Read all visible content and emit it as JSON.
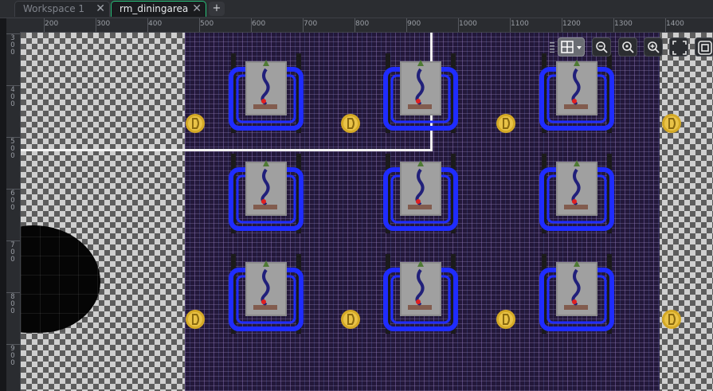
{
  "tabs": [
    {
      "label": "Workspace 1",
      "active": false
    },
    {
      "label": "rm_diningarea",
      "active": true
    }
  ],
  "tab_close_glyph": "✕",
  "tab_add_label": "+",
  "ruler": {
    "top_labels": [
      "200",
      "300",
      "400",
      "500",
      "600",
      "700",
      "800",
      "900",
      "1000",
      "1100",
      "1200",
      "1300",
      "1400"
    ],
    "left_labels": [
      "300",
      "400",
      "500",
      "600",
      "700",
      "800",
      "900"
    ]
  },
  "canvas_toolbar": {
    "buttons": [
      {
        "name": "grid-toggle-icon",
        "active": true
      },
      {
        "name": "zoom-out-icon",
        "active": false
      },
      {
        "name": "zoom-reset-icon",
        "active": false
      },
      {
        "name": "zoom-in-icon",
        "active": false
      },
      {
        "name": "fit-view-icon",
        "active": false
      },
      {
        "name": "frame-toggle-icon",
        "active": false
      }
    ]
  },
  "colors": {
    "accent_tab": "#27c27a",
    "table_frame": "#1f2cff",
    "coin": "#d4a925",
    "room_boundary": "#f2f2f2"
  }
}
